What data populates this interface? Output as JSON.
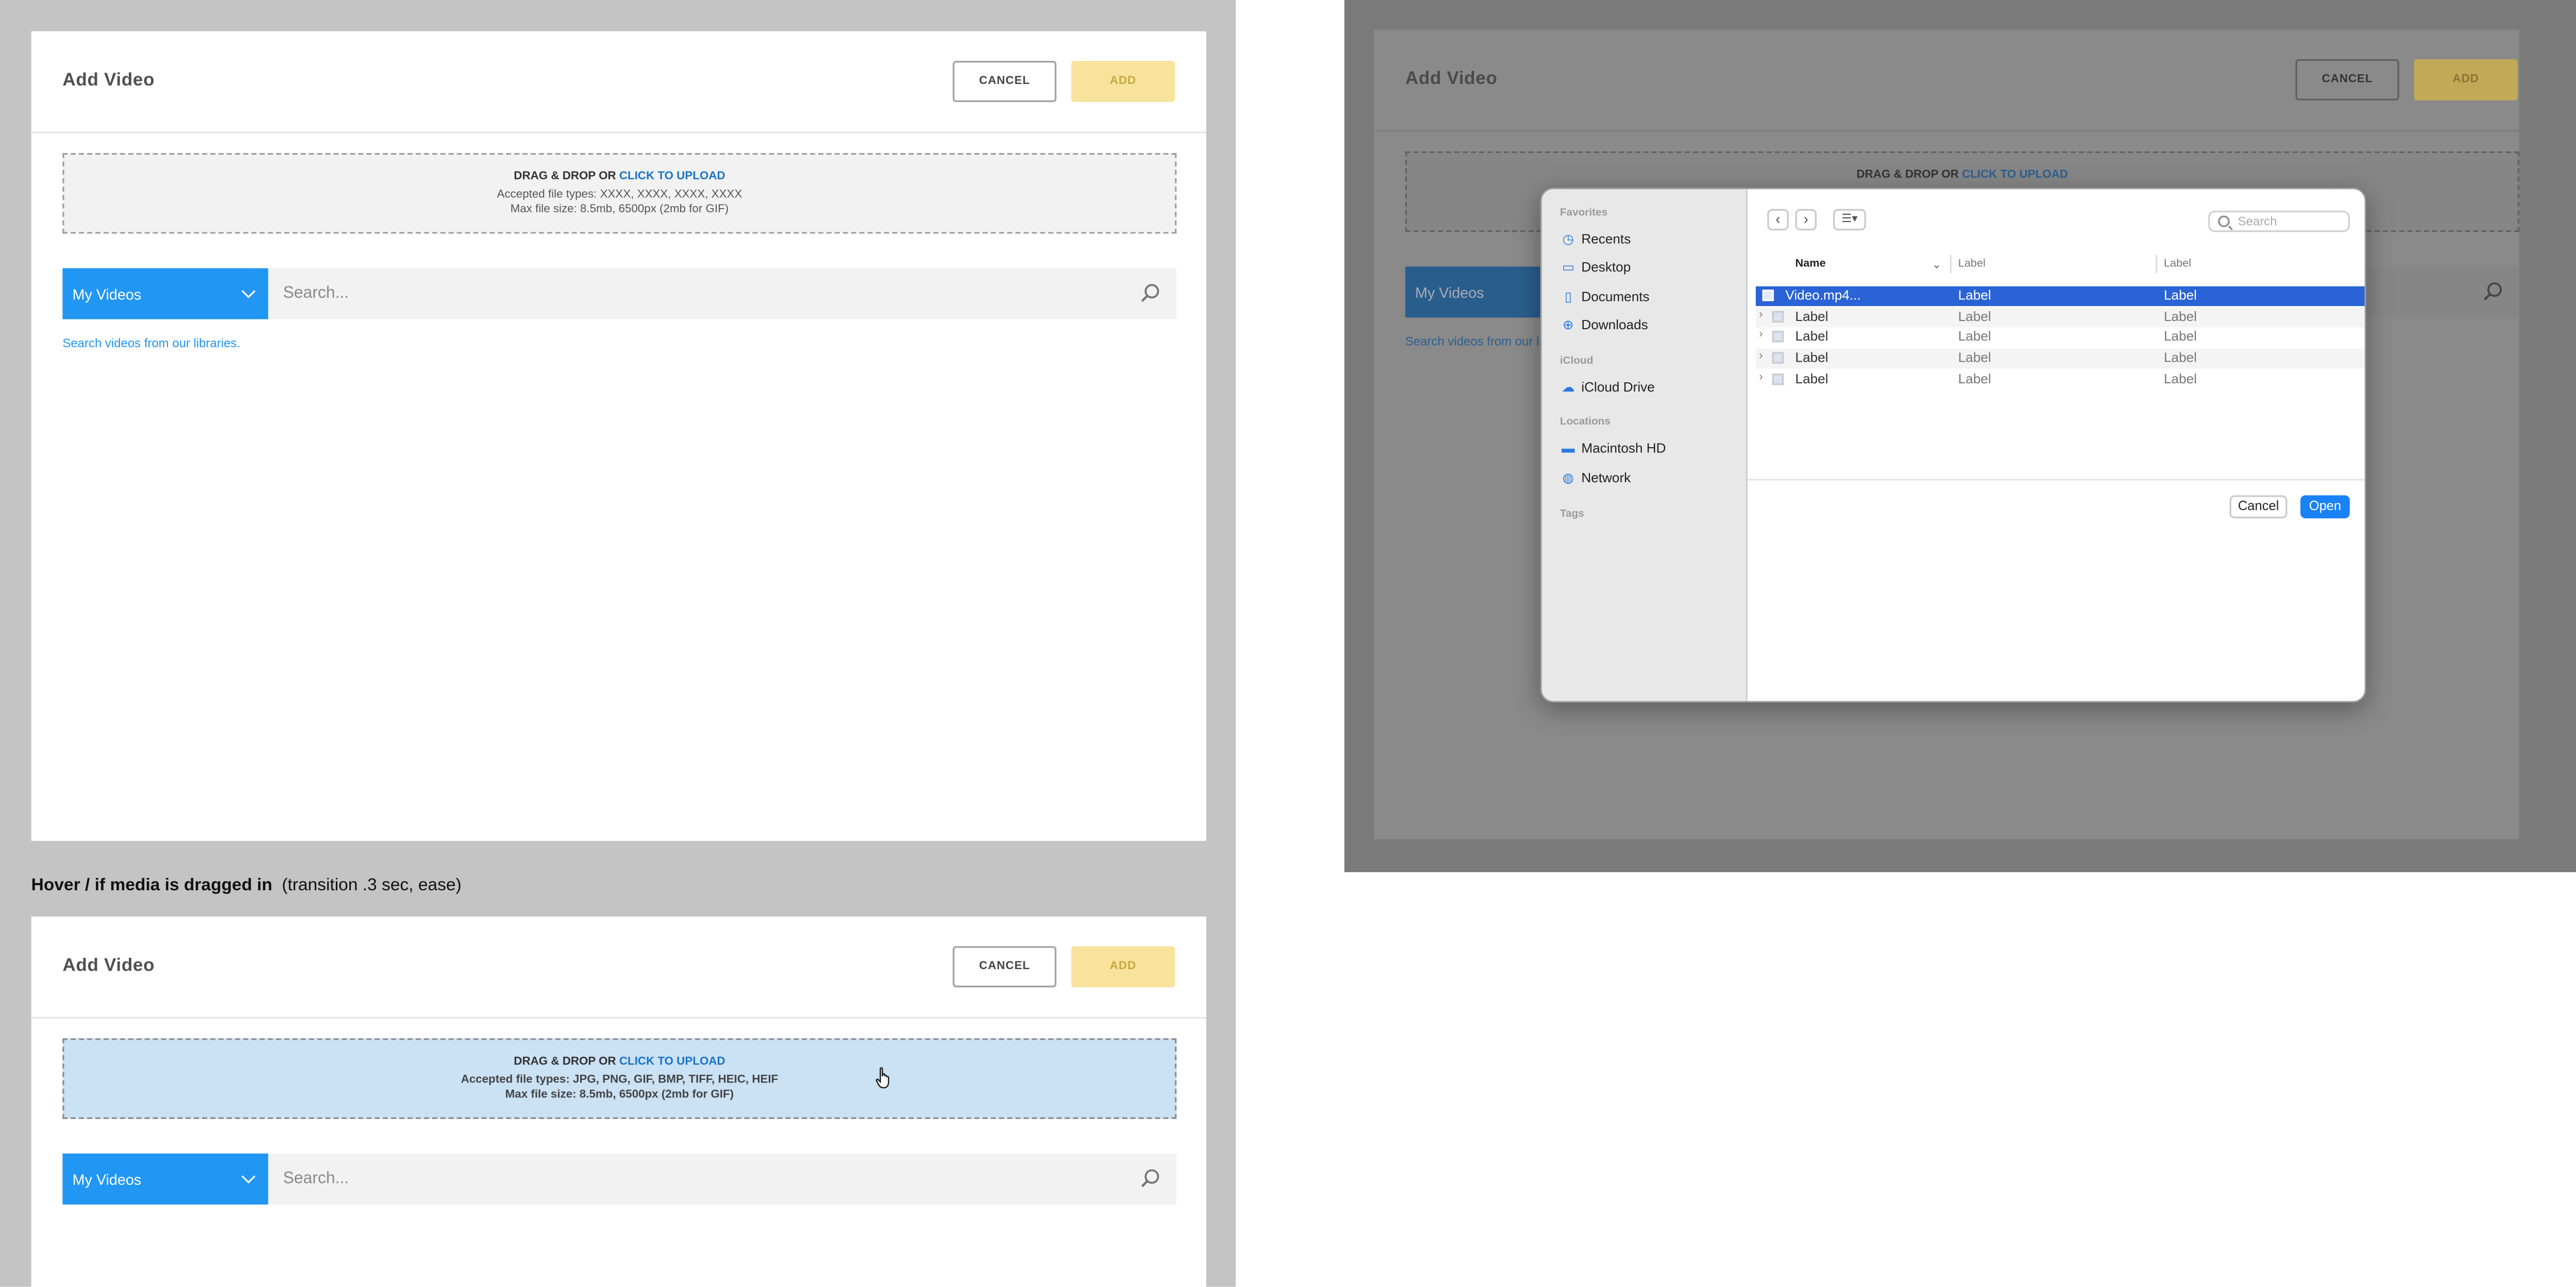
{
  "modal": {
    "title": "Add Video",
    "cancel": "CANCEL",
    "add": "ADD",
    "drop_drag": "DRAG & DROP OR",
    "drop_click": "CLICK TO UPLOAD",
    "drop_types": "Accepted file types: XXXX, XXXX, XXXX, XXXX",
    "drop_size": "Max file size: 8.5mb, 6500px  (2mb for GIF)",
    "library": "My Videos",
    "search_placeholder": "Search...",
    "helper": "Search videos from our libraries."
  },
  "note": {
    "bold": "Hover / if media is dragged in",
    "rest": "(transition .3 sec, ease)"
  },
  "hover_modal": {
    "drop_types": "Accepted file types: JPG, PNG, GIF, BMP, TIFF, HEIC, HEIF",
    "drop_size": "Max file size: 8.5mb, 6500px  (2mb for GIF)"
  },
  "file_dialog": {
    "sections": {
      "favorites": "Favorites",
      "icloud": "iCloud",
      "locations": "Locations",
      "tags": "Tags"
    },
    "items": {
      "recents": "Recents",
      "desktop": "Desktop",
      "documents": "Documents",
      "downloads": "Downloads",
      "icloud_drive": "iCloud Drive",
      "macintosh_hd": "Macintosh HD",
      "network": "Network"
    },
    "search_placeholder": "Search",
    "columns": [
      "Name",
      "Label",
      "Label"
    ],
    "rows": [
      [
        "Video.mp4...",
        "Label",
        "Label"
      ],
      [
        "Label",
        "Label",
        "Label"
      ],
      [
        "Label",
        "Label",
        "Label"
      ],
      [
        "Label",
        "Label",
        "Label"
      ],
      [
        "Label",
        "Label",
        "Label"
      ]
    ],
    "cancel": "Cancel",
    "open": "Open"
  }
}
